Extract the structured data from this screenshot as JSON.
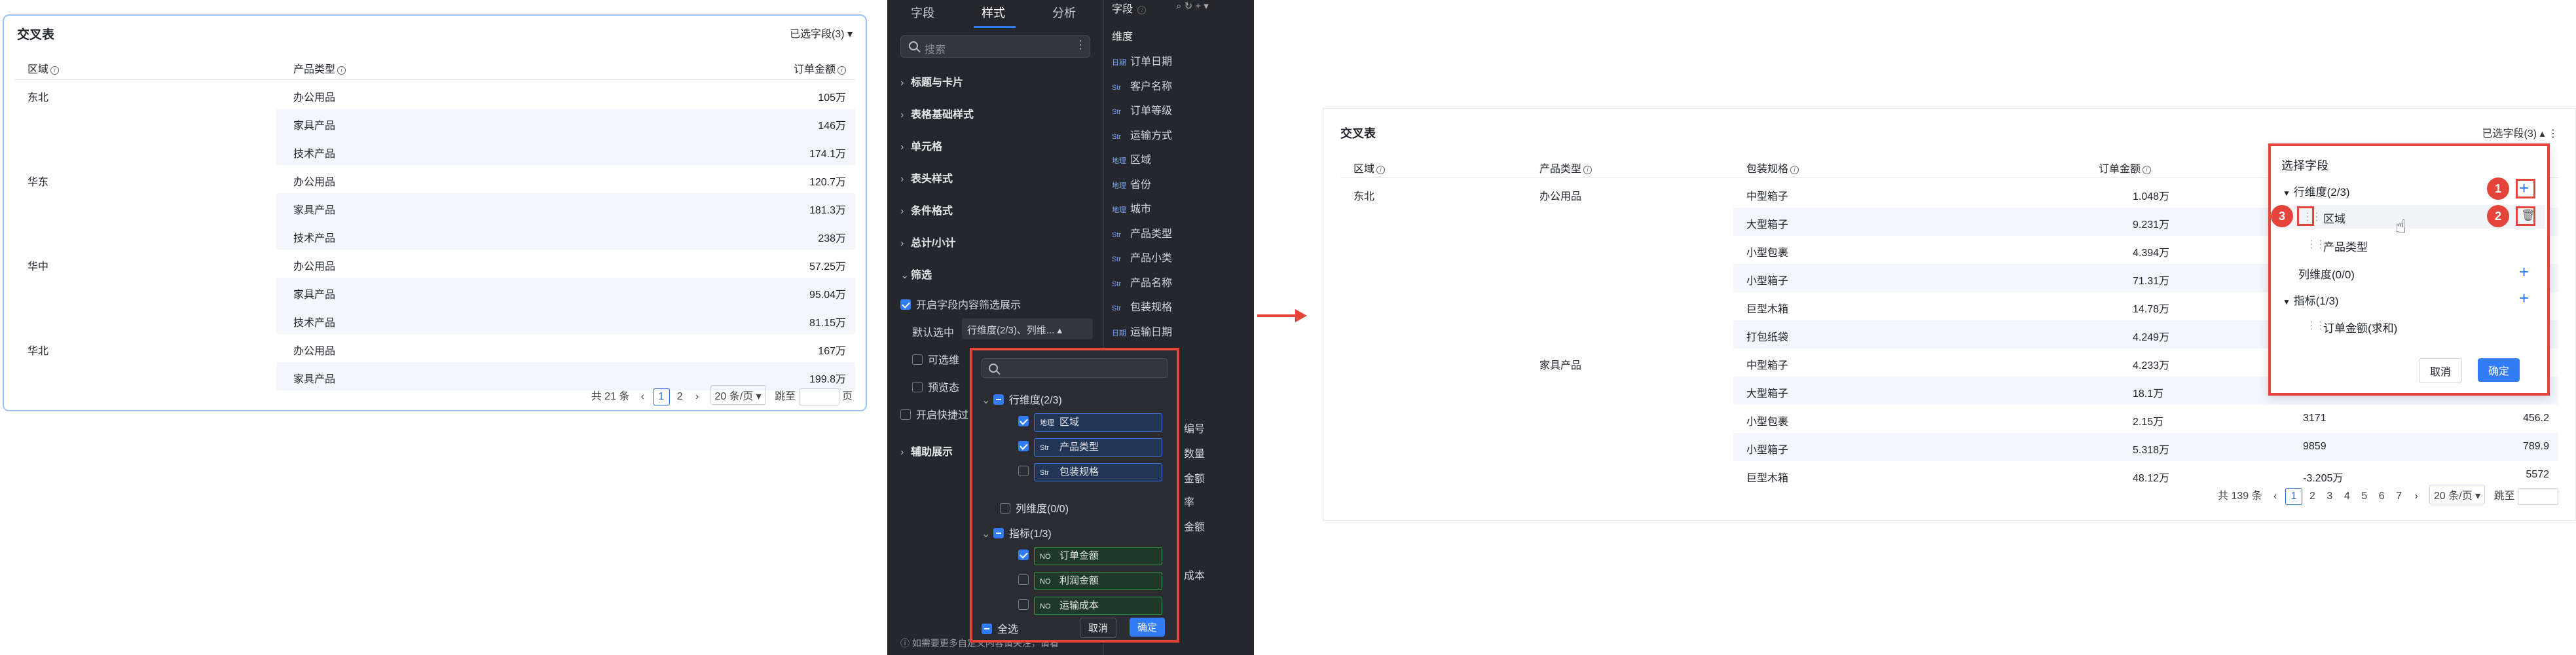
{
  "left_table": {
    "title": "交叉表",
    "selected_fields": "已选字段(3)",
    "headers": [
      "区域",
      "产品类型",
      "订单金额"
    ],
    "rows": [
      {
        "region": "东北",
        "type": "办公用品",
        "amount": "105万"
      },
      {
        "region": "",
        "type": "家具产品",
        "amount": "146万"
      },
      {
        "region": "",
        "type": "技术产品",
        "amount": "174.1万"
      },
      {
        "region": "华东",
        "type": "办公用品",
        "amount": "120.7万"
      },
      {
        "region": "",
        "type": "家具产品",
        "amount": "181.3万"
      },
      {
        "region": "",
        "type": "技术产品",
        "amount": "238万"
      },
      {
        "region": "华中",
        "type": "办公用品",
        "amount": "57.25万"
      },
      {
        "region": "",
        "type": "家具产品",
        "amount": "95.04万"
      },
      {
        "region": "",
        "type": "技术产品",
        "amount": "81.15万"
      },
      {
        "region": "华北",
        "type": "办公用品",
        "amount": "167万"
      },
      {
        "region": "",
        "type": "家具产品",
        "amount": "199.8万"
      }
    ],
    "pager": {
      "total": "共 21 条",
      "page1": "1",
      "page2": "2",
      "page_size": "20 条/页",
      "jump": "跳至",
      "page_unit": "页"
    }
  },
  "sidebar": {
    "tabs": [
      "字段",
      "样式",
      "分析"
    ],
    "search_placeholder": "搜索",
    "sections": [
      "标题与卡片",
      "表格基础样式",
      "单元格",
      "表头样式",
      "条件格式",
      "总计/小计",
      "筛选",
      "辅助展示"
    ],
    "filter_enable": "开启字段内容筛选展示",
    "default_selected_label": "默认选中",
    "default_selected_value": "行维度(2/3)、列维...",
    "opt_selectable": "可选维",
    "opt_preview": "预览态",
    "opt_quick": "开启快捷过",
    "footer_tip": "如需要更多自定义内容请关注，请看",
    "field_col": {
      "title": "字段",
      "dim_label": "维度",
      "items": [
        {
          "tag": "日期",
          "name": "订单日期"
        },
        {
          "tag": "Str",
          "name": "客户名称"
        },
        {
          "tag": "Str",
          "name": "订单等级"
        },
        {
          "tag": "Str",
          "name": "运输方式"
        },
        {
          "tag": "地理",
          "name": "区域"
        },
        {
          "tag": "地理",
          "name": "省份"
        },
        {
          "tag": "地理",
          "name": "城市"
        },
        {
          "tag": "Str",
          "name": "产品类型"
        },
        {
          "tag": "Str",
          "name": "产品小类"
        },
        {
          "tag": "Str",
          "name": "产品名称"
        },
        {
          "tag": "Str",
          "name": "包装规格"
        },
        {
          "tag": "日期",
          "name": "运输日期"
        }
      ],
      "partials": [
        "编号",
        "数量",
        "金额",
        "率",
        "金额",
        "成本"
      ]
    },
    "dropdown": {
      "group_row": "行维度(2/3)",
      "row_items": [
        {
          "tag": "地理",
          "label": "区域",
          "checked": true
        },
        {
          "tag": "Str",
          "label": "产品类型",
          "checked": true
        },
        {
          "tag": "Str",
          "label": "包装规格",
          "checked": false
        }
      ],
      "group_col": "列维度(0/0)",
      "group_metric": "指标(1/3)",
      "metric_items": [
        {
          "tag": "NO",
          "label": "订单金额",
          "checked": true
        },
        {
          "tag": "NO",
          "label": "利润金额",
          "checked": false
        },
        {
          "tag": "NO",
          "label": "运输成本",
          "checked": false
        }
      ],
      "select_all": "全选",
      "cancel": "取消",
      "ok": "确定"
    }
  },
  "right_table": {
    "title": "交叉表",
    "selected_fields": "已选字段(3)",
    "headers": [
      "区域",
      "产品类型",
      "包装规格",
      "订单金额"
    ],
    "rows": [
      {
        "region": "东北",
        "type": "办公用品",
        "pack": "中型箱子",
        "amount": "1.048万",
        "c5": "",
        "c6": ""
      },
      {
        "region": "",
        "type": "",
        "pack": "大型箱子",
        "amount": "9.231万",
        "c5": "",
        "c6": ""
      },
      {
        "region": "",
        "type": "",
        "pack": "小型包裹",
        "amount": "4.394万",
        "c5": "",
        "c6": ""
      },
      {
        "region": "",
        "type": "",
        "pack": "小型箱子",
        "amount": "71.31万",
        "c5": "",
        "c6": ""
      },
      {
        "region": "",
        "type": "",
        "pack": "巨型木箱",
        "amount": "14.78万",
        "c5": "",
        "c6": ""
      },
      {
        "region": "",
        "type": "",
        "pack": "打包纸袋",
        "amount": "4.249万",
        "c5": "",
        "c6": ""
      },
      {
        "region": "",
        "type": "家具产品",
        "pack": "中型箱子",
        "amount": "4.233万",
        "c5": "",
        "c6": ""
      },
      {
        "region": "",
        "type": "",
        "pack": "大型箱子",
        "amount": "18.1万",
        "c5": "",
        "c6": ""
      },
      {
        "region": "",
        "type": "",
        "pack": "小型包裹",
        "amount": "2.15万",
        "c5": "3171",
        "c6": "456.2"
      },
      {
        "region": "",
        "type": "",
        "pack": "小型箱子",
        "amount": "5.318万",
        "c5": "9859",
        "c6": "789.9"
      },
      {
        "region": "",
        "type": "",
        "pack": "巨型木箱",
        "amount": "48.12万",
        "c5": "-3.205万",
        "c6": "5572"
      }
    ],
    "pager": {
      "total": "共 139 条",
      "pages": [
        "1",
        "2",
        "3",
        "4",
        "5",
        "6",
        "7"
      ],
      "page_size": "20 条/页",
      "jump": "跳至"
    },
    "dialog": {
      "title": "选择字段",
      "row_group": "行维度(2/3)",
      "row_items": [
        "区域",
        "产品类型"
      ],
      "col_group": "列维度(0/0)",
      "metric_group": "指标(1/3)",
      "metric_items": [
        "订单金额(求和)"
      ],
      "badges": [
        "1",
        "2",
        "3"
      ],
      "cancel": "取消",
      "ok": "确定"
    }
  },
  "colors": {
    "accent": "#2f7cf6",
    "highlight": "#e5443a",
    "dark_bg": "#25272c"
  }
}
